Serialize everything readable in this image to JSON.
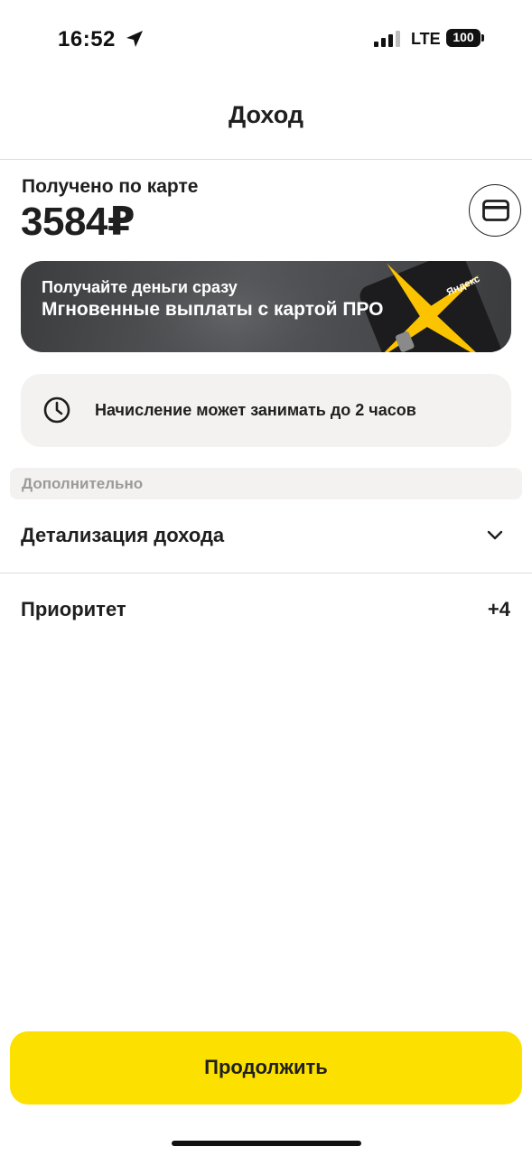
{
  "status_bar": {
    "time": "16:52",
    "network": "LTE",
    "battery": "100",
    "icons": [
      "location-arrow-icon",
      "signal-icon",
      "battery-icon"
    ]
  },
  "header": {
    "title": "Доход"
  },
  "balance": {
    "label": "Получено по карте",
    "amount": "3584₽",
    "card_button_icon": "credit-card-icon"
  },
  "promo": {
    "subtitle": "Получайте деньги сразу",
    "title": "Мгновенные выплаты с картой ПРО",
    "card_brand": "Яндекс",
    "accent_color": "#fcc400"
  },
  "info": {
    "icon": "clock-icon",
    "text": "Начисление может занимать до 2 часов"
  },
  "section": {
    "header": "Дополнительно",
    "rows": [
      {
        "label": "Детализация дохода",
        "icon": "chevron-down-icon"
      },
      {
        "label": "Приоритет",
        "value": "+4"
      }
    ]
  },
  "footer": {
    "continue_label": "Продолжить",
    "button_color": "#fce000"
  }
}
